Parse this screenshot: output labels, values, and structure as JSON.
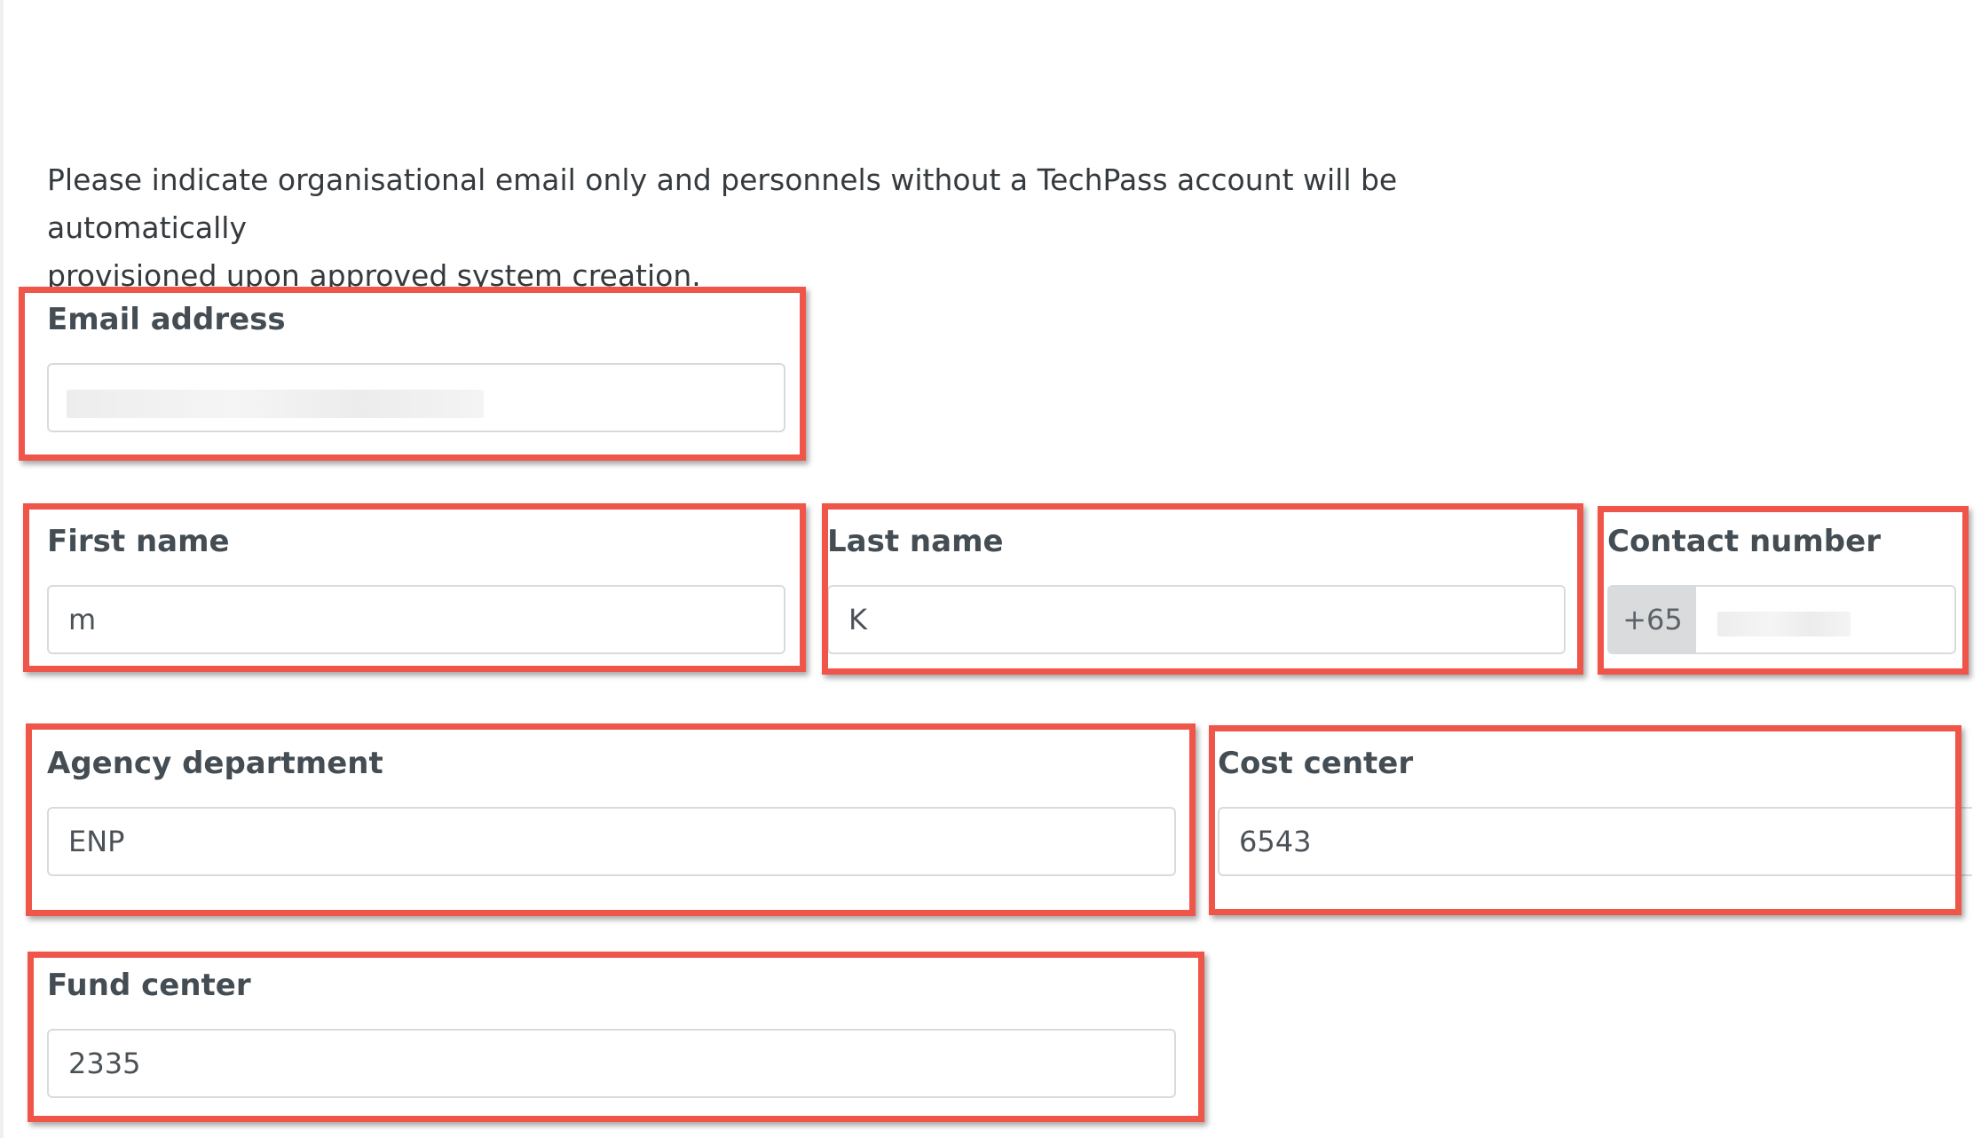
{
  "intro": {
    "line1": "Please indicate organisational email only and personnels without a TechPass account will be automatically",
    "line2": "provisioned upon approved system creation."
  },
  "fields": {
    "email": {
      "label": "Email address",
      "value": ""
    },
    "first_name": {
      "label": "First name",
      "value": "m"
    },
    "last_name": {
      "label": "Last name",
      "value": "K"
    },
    "contact_number": {
      "label": "Contact number",
      "prefix": "+65",
      "value": ""
    },
    "agency_department": {
      "label": "Agency department",
      "value": "ENP"
    },
    "cost_center": {
      "label": "Cost center",
      "value": "6543"
    },
    "fund_center": {
      "label": "Fund center",
      "value": "2335"
    }
  },
  "colors": {
    "highlight": "#f0554a",
    "input_border": "#d8dbdd",
    "prefix_bg": "#d9dbdd",
    "label_text": "#444d53"
  }
}
